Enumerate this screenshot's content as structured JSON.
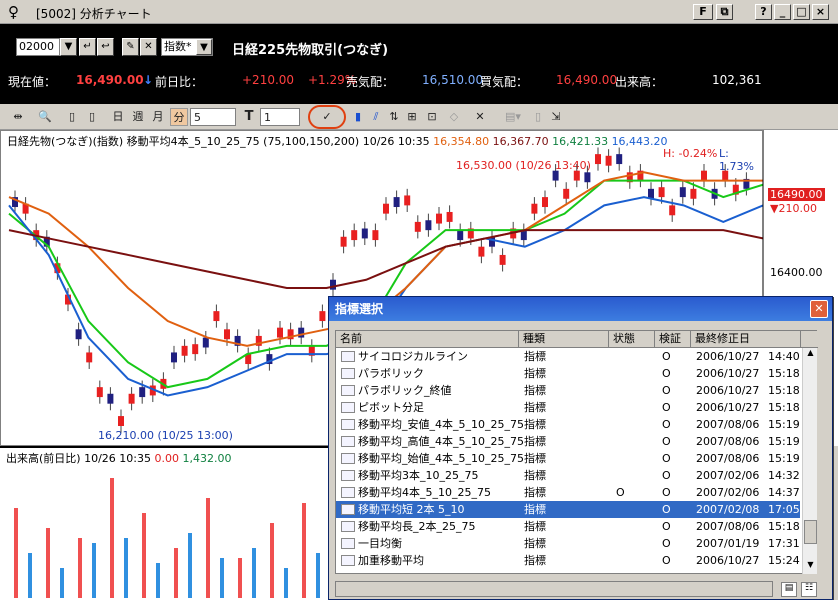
{
  "window": {
    "title": "[5002] 分析チャート",
    "buttons": [
      "F",
      "?",
      "_",
      "□",
      "×"
    ]
  },
  "header": {
    "code": "02000",
    "type_select": "指数*",
    "symbol_name": "日経225先物取引(つなぎ)",
    "quote": {
      "current_label": "現在値：",
      "current_value": "16,490.00",
      "arrow": "↓",
      "prev_label": "前日比：",
      "change": "+210.00",
      "change_pct": "+1.29%",
      "ask_label": "売気配：",
      "ask_value": "16,510.00",
      "bid_label": "買気配：",
      "bid_value": "16,490.00",
      "volume_label": "出来高：",
      "volume_value": "102,361"
    }
  },
  "toolbar": {
    "day": "日",
    "week": "週",
    "month": "月",
    "minute": "分",
    "interval": "5",
    "text_tool": "T",
    "line_width": "1"
  },
  "chart": {
    "legend": {
      "title": "日経先物(つなぎ)(指数) 移動平均4本_5_10_25_75 (75,100,150,200) 10/26 10:35",
      "v1": "16,354.80",
      "v2": "16,367.70",
      "v3": "16,421.33",
      "v4": "16,443.20"
    },
    "high_annotation": "16,530.00 (10/26 13:40)",
    "low_annotation": "16,210.00 (10/25 13:00)",
    "h_label": "H: -0.24%",
    "l_label": "L: 1.73%",
    "axis": {
      "current": "16490.00",
      "change": "210.00",
      "tick": "16400.00"
    },
    "colors": {
      "ma5": "#18c818",
      "ma10": "#1a5fd0",
      "ma25": "#e06010",
      "ma75": "#7a1010",
      "up": "#e82020",
      "down": "#202080"
    }
  },
  "chart_data": {
    "type": "line",
    "title": "日経先物(つなぎ)(指数) 移動平均4本_5_10_25_75",
    "series": [
      {
        "name": "16,354.80",
        "values": []
      },
      {
        "name": "16,367.70",
        "values": []
      },
      {
        "name": "16,421.33",
        "values": []
      },
      {
        "name": "16,443.20",
        "values": []
      }
    ],
    "markers": {
      "high": 16530.0,
      "low": 16210.0,
      "current": 16490.0
    }
  },
  "volume": {
    "legend_label": "出来高(前日比) 10/26 10:35",
    "legend_v1": "0.00",
    "legend_v2": "1,432.00",
    "bars_red": [
      90,
      70,
      60,
      120,
      85,
      50,
      100,
      40,
      75,
      95
    ],
    "bars_blue": [
      45,
      30,
      55,
      60,
      35,
      65,
      40,
      50,
      30,
      45
    ]
  },
  "dialog": {
    "title": "指標選択",
    "columns": [
      "名前",
      "種類",
      "状態",
      "検証",
      "最終修正日"
    ],
    "rows": [
      {
        "name": "サイコロジカルライン",
        "kind": "指標",
        "state": "",
        "verify": "O",
        "date": "2006/10/27",
        "time": "14:40"
      },
      {
        "name": "パラボリック",
        "kind": "指標",
        "state": "",
        "verify": "O",
        "date": "2006/10/27",
        "time": "15:18"
      },
      {
        "name": "パラボリック_終値",
        "kind": "指標",
        "state": "",
        "verify": "O",
        "date": "2006/10/27",
        "time": "15:18"
      },
      {
        "name": "ピボット分足",
        "kind": "指標",
        "state": "",
        "verify": "O",
        "date": "2006/10/27",
        "time": "15:18"
      },
      {
        "name": "移動平均_安値_4本_5_10_25_75",
        "kind": "指標",
        "state": "",
        "verify": "O",
        "date": "2007/08/06",
        "time": "15:19"
      },
      {
        "name": "移動平均_高値_4本_5_10_25_75",
        "kind": "指標",
        "state": "",
        "verify": "O",
        "date": "2007/08/06",
        "time": "15:19"
      },
      {
        "name": "移動平均_始値_4本_5_10_25_75",
        "kind": "指標",
        "state": "",
        "verify": "O",
        "date": "2007/08/06",
        "time": "15:19"
      },
      {
        "name": "移動平均3本_10_25_75",
        "kind": "指標",
        "state": "",
        "verify": "O",
        "date": "2007/02/06",
        "time": "14:32"
      },
      {
        "name": "移動平均4本_5_10_25_75",
        "kind": "指標",
        "state": "O",
        "verify": "O",
        "date": "2007/02/06",
        "time": "14:37"
      },
      {
        "name": "移動平均短 2本 5_10",
        "kind": "指標",
        "state": "",
        "verify": "O",
        "date": "2007/02/08",
        "time": "17:05",
        "selected": true
      },
      {
        "name": "移動平均長_2本_25_75",
        "kind": "指標",
        "state": "",
        "verify": "O",
        "date": "2007/08/06",
        "time": "15:18"
      },
      {
        "name": "一目均衡",
        "kind": "指標",
        "state": "",
        "verify": "O",
        "date": "2007/01/19",
        "time": "17:31"
      },
      {
        "name": "加重移動平均",
        "kind": "指標",
        "state": "",
        "verify": "O",
        "date": "2006/10/27",
        "time": "15:24"
      }
    ]
  }
}
